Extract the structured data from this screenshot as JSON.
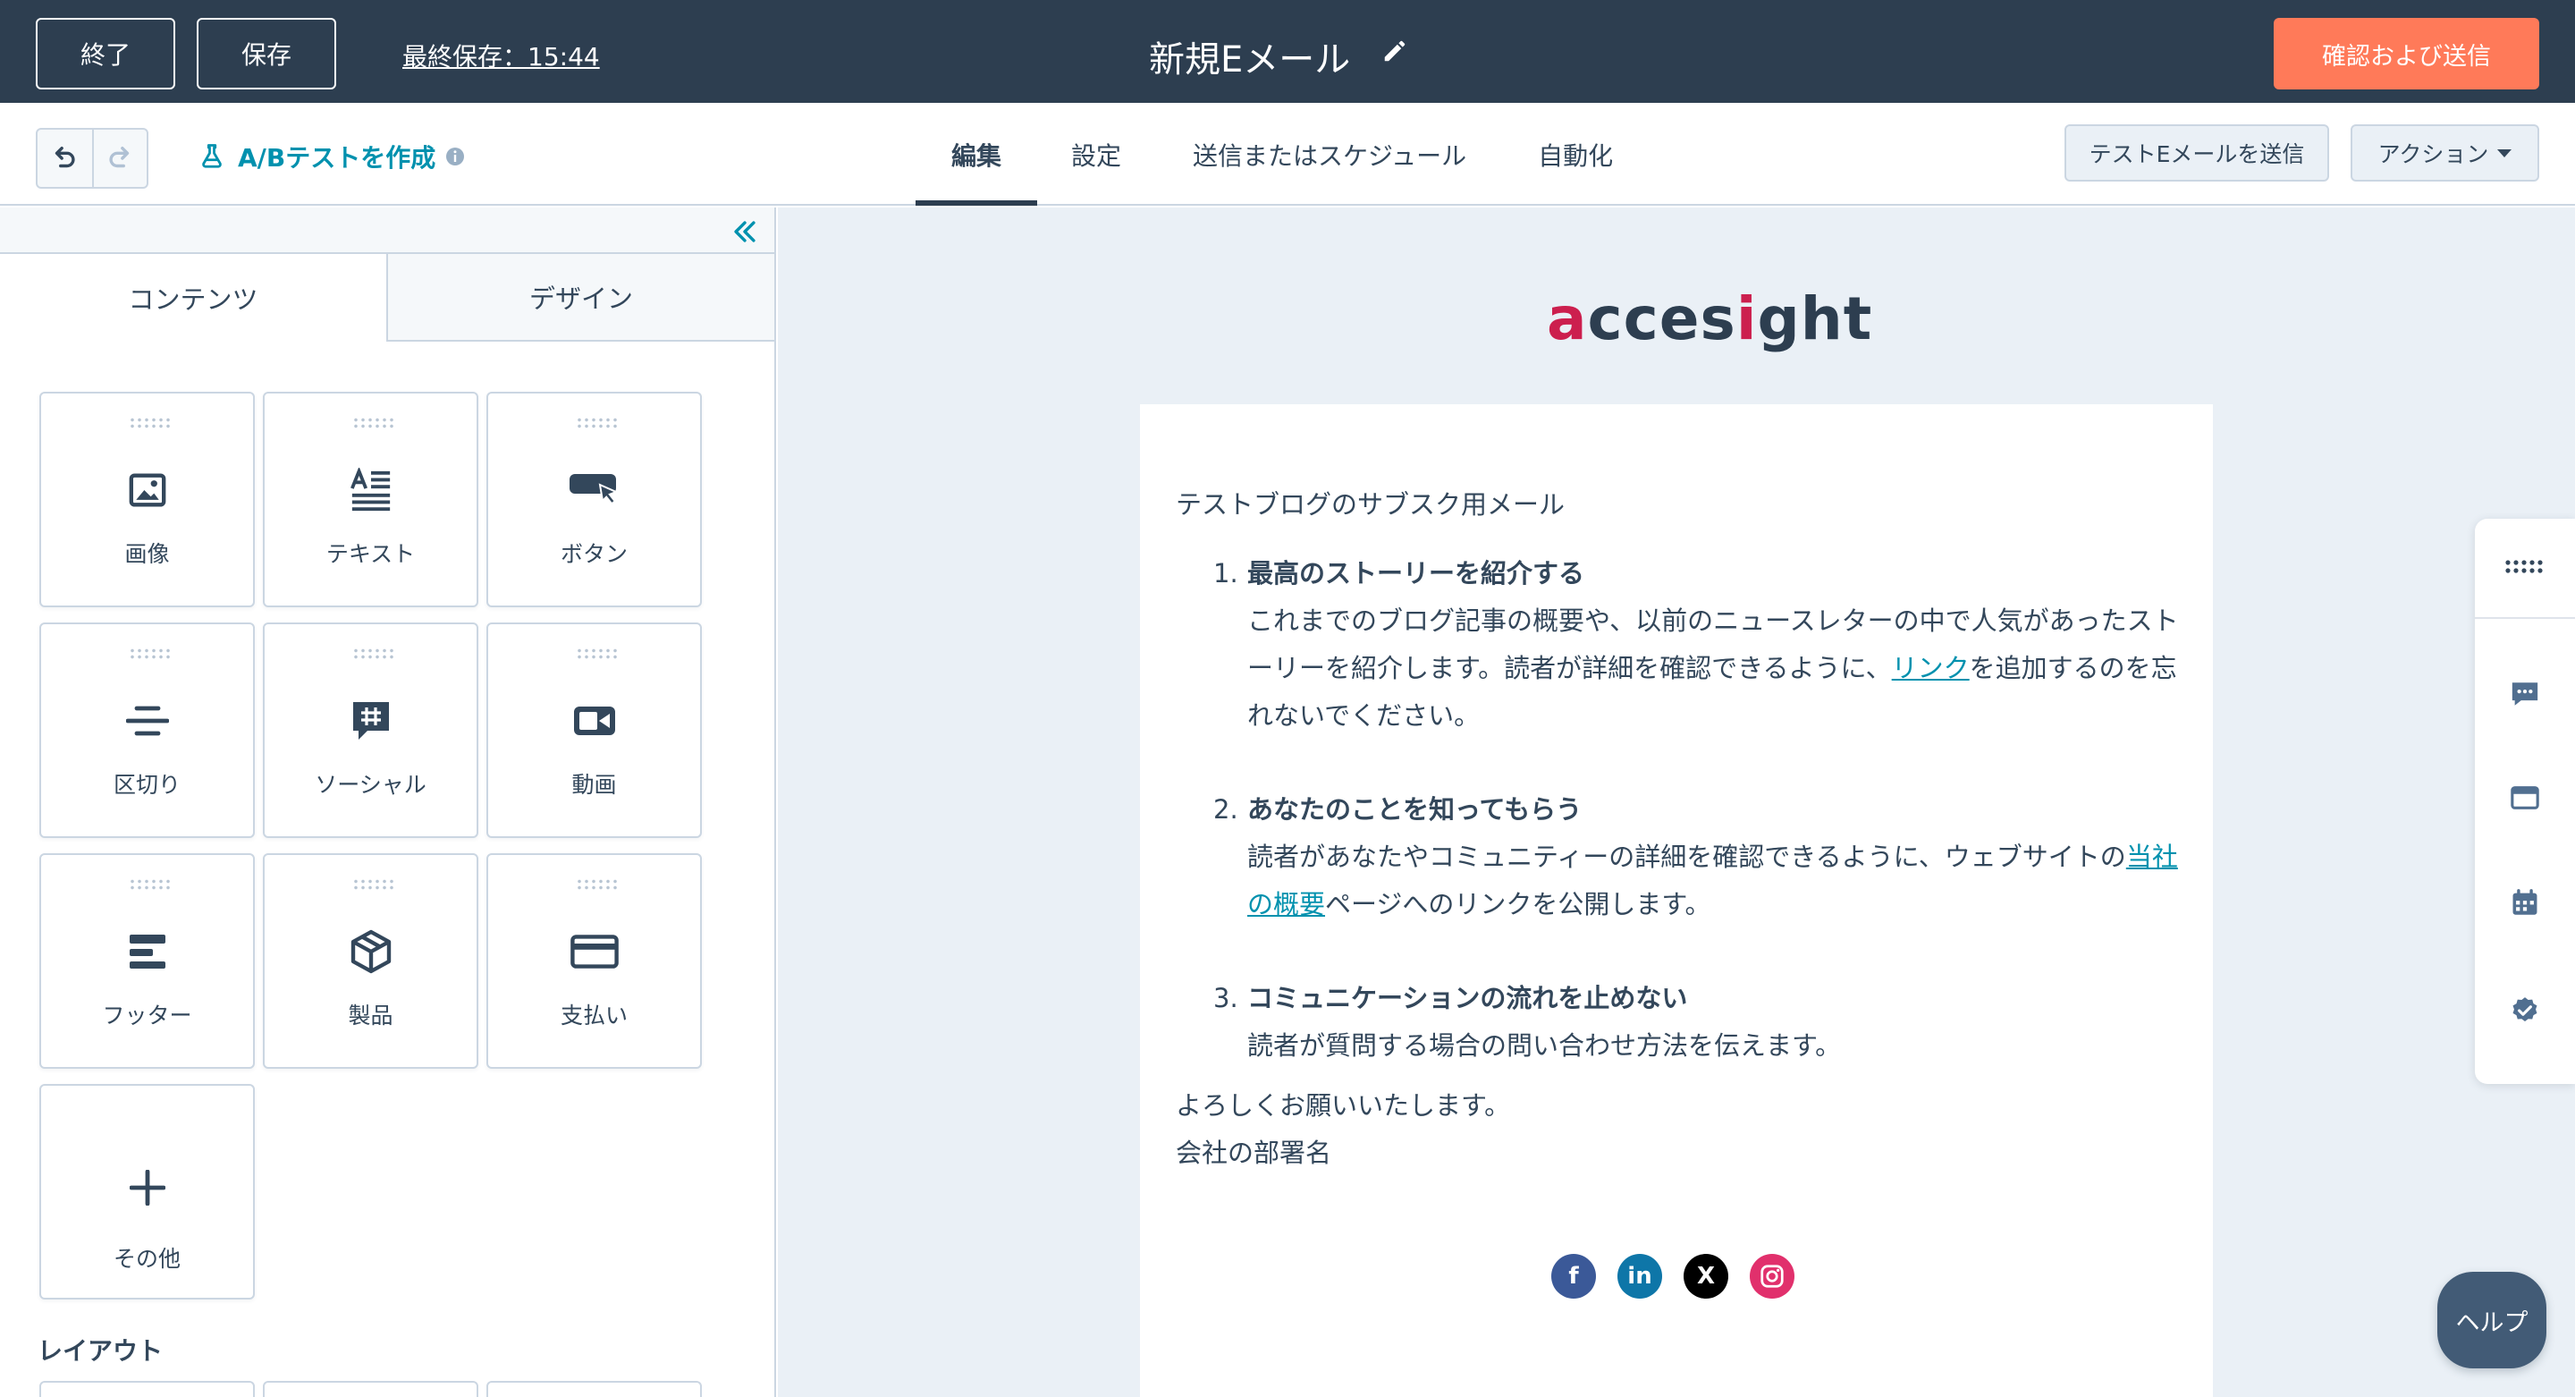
{
  "topbar": {
    "exit_label": "終了",
    "save_label": "保存",
    "last_saved": "最終保存：15:44",
    "email_title": "新規Eメール",
    "send_label": "確認および送信"
  },
  "subbar": {
    "ab_test_label": "A/Bテストを作成",
    "tabs": [
      "編集",
      "設定",
      "送信またはスケジュール",
      "自動化"
    ],
    "active_tab": "編集",
    "test_email_label": "テストEメールを送信",
    "actions_label": "アクション"
  },
  "left_panel": {
    "tabs": [
      "コンテンツ",
      "デザイン"
    ],
    "active_tab": "コンテンツ",
    "modules": [
      {
        "label": "画像",
        "icon": "image-icon"
      },
      {
        "label": "テキスト",
        "icon": "text-icon"
      },
      {
        "label": "ボタン",
        "icon": "button-icon"
      },
      {
        "label": "区切り",
        "icon": "divider-icon"
      },
      {
        "label": "ソーシャル",
        "icon": "social-icon"
      },
      {
        "label": "動画",
        "icon": "video-icon"
      },
      {
        "label": "フッター",
        "icon": "footer-icon"
      },
      {
        "label": "製品",
        "icon": "product-icon"
      },
      {
        "label": "支払い",
        "icon": "payment-icon"
      }
    ],
    "more_label": "その他",
    "layout_heading": "レイアウト"
  },
  "email": {
    "logo": {
      "prefix": "a",
      "middle1": "cces",
      "accent": "i",
      "suffix": "ght"
    },
    "intro": "テストブログのサブスク用メール",
    "items": [
      {
        "number": "1.",
        "title": "最高のストーリーを紹介する",
        "body_before": "これまでのブログ記事の概要や、以前のニュースレターの中で人気があったストーリーを紹介します。読者が詳細を確認できるように、",
        "link": "リンク",
        "body_after": "を追加するのを忘れないでください。"
      },
      {
        "number": "2.",
        "title": "あなたのことを知ってもらう",
        "body_before": "読者があなたやコミュニティーの詳細を確認できるように、ウェブサイトの",
        "link": "当社の概要",
        "body_after": "ページへのリンクを公開します。"
      },
      {
        "number": "3.",
        "title": "コミュニケーションの流れを止めない",
        "body_before": "読者が質問する場合の問い合わせ方法を伝えます。",
        "link": "",
        "body_after": ""
      }
    ],
    "closing": "よろしくお願いいたします。",
    "department": "会社の部署名",
    "social_icons": [
      "facebook-icon",
      "linkedin-icon",
      "x-icon",
      "instagram-icon"
    ]
  },
  "side_tools": [
    "grid-icon",
    "comment-icon",
    "preview-icon",
    "calendar-icon",
    "check-badge-icon"
  ],
  "help_label": "ヘルプ",
  "colors": {
    "topbar_bg": "#2d3e50",
    "primary_orange": "#ff7a59",
    "link_teal": "#0091ae",
    "canvas_bg": "#eaf0f6",
    "logo_accent": "#cc1f4e"
  }
}
